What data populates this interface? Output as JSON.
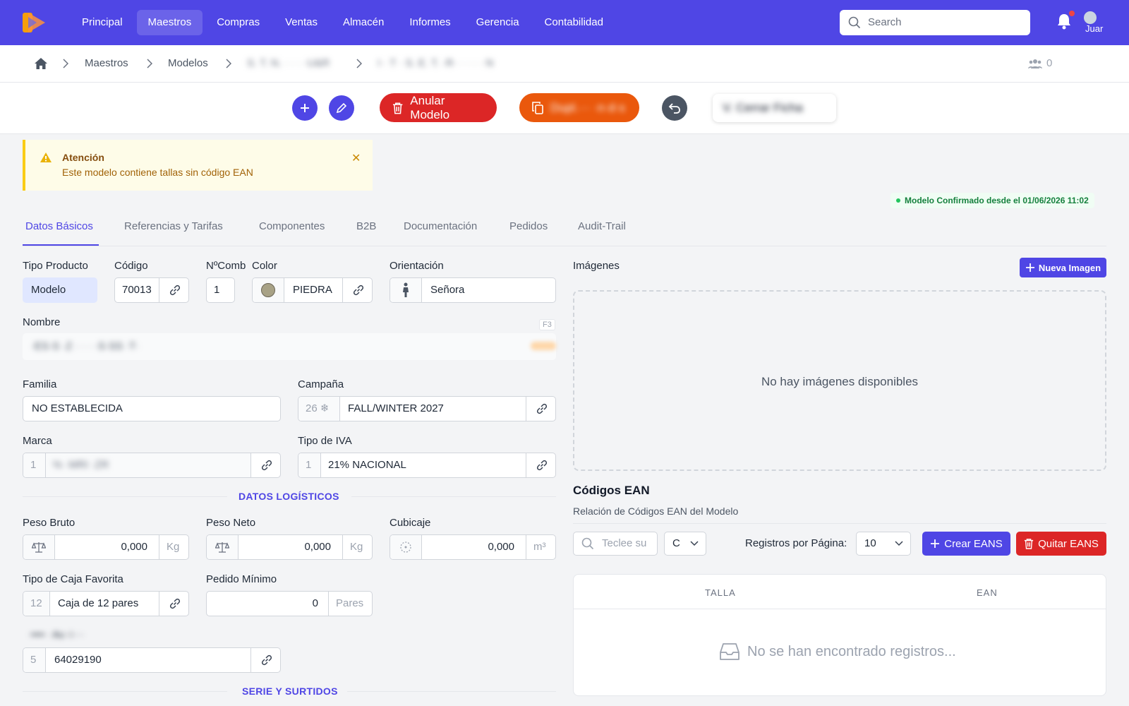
{
  "nav": {
    "items": [
      "Principal",
      "Maestros",
      "Compras",
      "Ventas",
      "Almacén",
      "Informes",
      "Gerencia",
      "Contabilidad"
    ],
    "active": "Maestros",
    "search_placeholder": "Search",
    "avatar_text": "Juar"
  },
  "breadcrumb": {
    "items": [
      "Maestros",
      "Modelos",
      "S. T. N. · · · ·U&R",
      "I · T · S. E. T. ·R· · · · · N"
    ],
    "users_count": "0"
  },
  "toolbar": {
    "anular_label": "Anular Modelo",
    "duplicate_label": "Dupl.··· ·n·d·s",
    "extra_label": "V. Cerrar Ficha"
  },
  "alert": {
    "title": "Atención",
    "message": "Este modelo contiene tallas sin código EAN",
    "close": "✕"
  },
  "status": "Modelo Confirmado desde el 01/06/2026 11:02",
  "tabs": [
    "Datos Básicos",
    "Referencias y Tarifas",
    "Componentes",
    "B2B",
    "Documentación",
    "Pedidos",
    "Audit-Trail"
  ],
  "active_tab": "Datos Básicos",
  "form": {
    "tipo_producto": {
      "label": "Tipo Producto",
      "value": "Modelo"
    },
    "codigo": {
      "label": "Código",
      "value": "70013"
    },
    "ncomb": {
      "label": "NºComb",
      "value": "1"
    },
    "color": {
      "label": "Color",
      "value": "PIEDRA",
      "swatch": "#a8a286"
    },
    "orientacion": {
      "label": "Orientación",
      "value": "Señora"
    },
    "nombre": {
      "label": "Nombre",
      "shortcut": "F3",
      "value": "·ES·S ·Z · · · ·S·SS ·T·"
    },
    "familia": {
      "label": "Familia",
      "value": "NO ESTABLECIDA"
    },
    "campana": {
      "label": "Campaña",
      "code": "26",
      "value": "FALL/WINTER 2027"
    },
    "marca": {
      "label": "Marca",
      "code": "1",
      "value": "% ·MRI ·ZR"
    },
    "iva": {
      "label": "Tipo de IVA",
      "code": "1",
      "value": "21% NACIONAL"
    },
    "logistica_title": "DATOS LOGÍSTICOS",
    "peso_bruto": {
      "label": "Peso Bruto",
      "value": "0,000",
      "unit": "Kg"
    },
    "peso_neto": {
      "label": "Peso Neto",
      "value": "0,000",
      "unit": "Kg"
    },
    "cubicaje": {
      "label": "Cubicaje",
      "value": "0,000",
      "unit": "m³"
    },
    "caja": {
      "label": "Tipo de Caja Favorita",
      "code": "12",
      "value": "Caja de 12 pares"
    },
    "pedido_minimo": {
      "label": "Pedido Mínimo",
      "value": "0",
      "unit": "Pares"
    },
    "arancel": {
      "label": "·••••· ·Au··i····",
      "code": "5",
      "value": "64029190"
    },
    "serie_title": "SERIE Y SURTIDOS"
  },
  "images": {
    "label": "Imágenes",
    "new_button": "Nueva Imagen",
    "empty": "No hay imágenes disponibles"
  },
  "ean": {
    "title": "Códigos EAN",
    "subtitle": "Relación de Códigos EAN del Modelo",
    "search_placeholder": "Teclee su",
    "filter_value": "C",
    "per_page_label": "Registros por Página:",
    "per_page": "10",
    "create_label": "Crear EANS",
    "remove_label": "Quitar EANS",
    "columns": [
      "TALLA",
      "EAN"
    ],
    "empty": "No se han encontrado registros..."
  },
  "colors": {
    "brand": "#4f46e5",
    "danger": "#dc2626",
    "orange": "#ea580c",
    "success": "#15803d"
  }
}
